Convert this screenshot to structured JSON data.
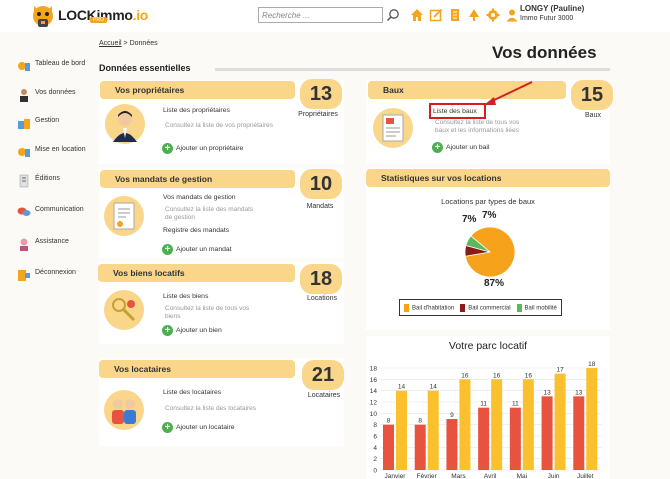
{
  "header": {
    "logo_text_main": "LOCKimmo",
    "logo_text_io": ".io",
    "logo_badge": "PRO",
    "search_placeholder": "Recherche ...",
    "user_name": "LONGY (Pauline)",
    "user_company": "Immo Futur 3000"
  },
  "sidebar": {
    "items": [
      {
        "label": "Tableau de bord"
      },
      {
        "label": "Vos données"
      },
      {
        "label": "Gestion"
      },
      {
        "label": "Mise en location"
      },
      {
        "label": "Éditions"
      },
      {
        "label": "Communication"
      },
      {
        "label": "Assistance"
      },
      {
        "label": "Déconnexion"
      }
    ]
  },
  "breadcrumb": {
    "home": "Accueil",
    "sep": ">",
    "current": "Données"
  },
  "page_title": "Vos données",
  "section_title": "Données essentielles",
  "cards": {
    "owners": {
      "title": "Vos propriétaires",
      "count": "13",
      "count_label": "Propriétaires",
      "link": "Liste des propriétaires",
      "desc": "Consultez la liste de vos propriétaires",
      "add": "Ajouter un propriétaire"
    },
    "mandates": {
      "title": "Vos mandats de gestion",
      "count": "10",
      "count_label": "Mandats",
      "link": "Vos mandats de gestion",
      "desc": "Consultez la liste des mandats de gestion",
      "link2": "Registre des mandats",
      "add": "Ajouter un mandat"
    },
    "rentals": {
      "title": "Vos biens locatifs",
      "count": "18",
      "count_label": "Locations",
      "link": "Liste des biens",
      "desc": "Consultez la liste de tous vos biens",
      "add": "Ajouter un bien"
    },
    "tenants": {
      "title": "Vos locataires",
      "count": "21",
      "count_label": "Locataires",
      "link": "Liste des locataires",
      "desc": "Consultez la liste des locataires",
      "add": "Ajouter un locataire"
    },
    "leases": {
      "title": "Baux",
      "count": "15",
      "count_label": "Baux",
      "link": "Liste des baux",
      "desc": "Consultez la liste de tous vos baux et les informations liées",
      "add": "Ajouter un bail"
    }
  },
  "stats": {
    "title": "Statistiques sur vos locations",
    "pie_title": "Locations par types de baux"
  },
  "chart_data": [
    {
      "type": "pie",
      "title": "Locations par types de baux",
      "categories": [
        "Bail d'habitation",
        "Bail commercial",
        "Bail mobilité"
      ],
      "values": [
        87,
        7,
        7
      ],
      "labels": [
        "87%",
        "7%",
        "7%"
      ],
      "colors": [
        "#f7a21b",
        "#8b1a1a",
        "#5cb85c"
      ],
      "legend": "bottom"
    },
    {
      "type": "bar",
      "title": "Votre parc locatif",
      "categories": [
        "Janvier",
        "Février",
        "Mars",
        "Avril",
        "Mai",
        "Juin",
        "Juillet"
      ],
      "series": [
        {
          "values": [
            8,
            8,
            9,
            11,
            11,
            13,
            13
          ],
          "color": "#e8533f"
        },
        {
          "values": [
            14,
            14,
            16,
            16,
            16,
            17,
            18
          ],
          "color": "#fbc02d"
        }
      ],
      "ylim": [
        0,
        18
      ],
      "yticks": [
        0,
        2,
        4,
        6,
        8,
        10,
        12,
        14,
        16,
        18
      ],
      "grid": true
    }
  ],
  "colors": {
    "accent": "#f4a51c",
    "card_head": "#f9d68a",
    "add_green": "#4caf50",
    "highlight": "#d02020"
  }
}
